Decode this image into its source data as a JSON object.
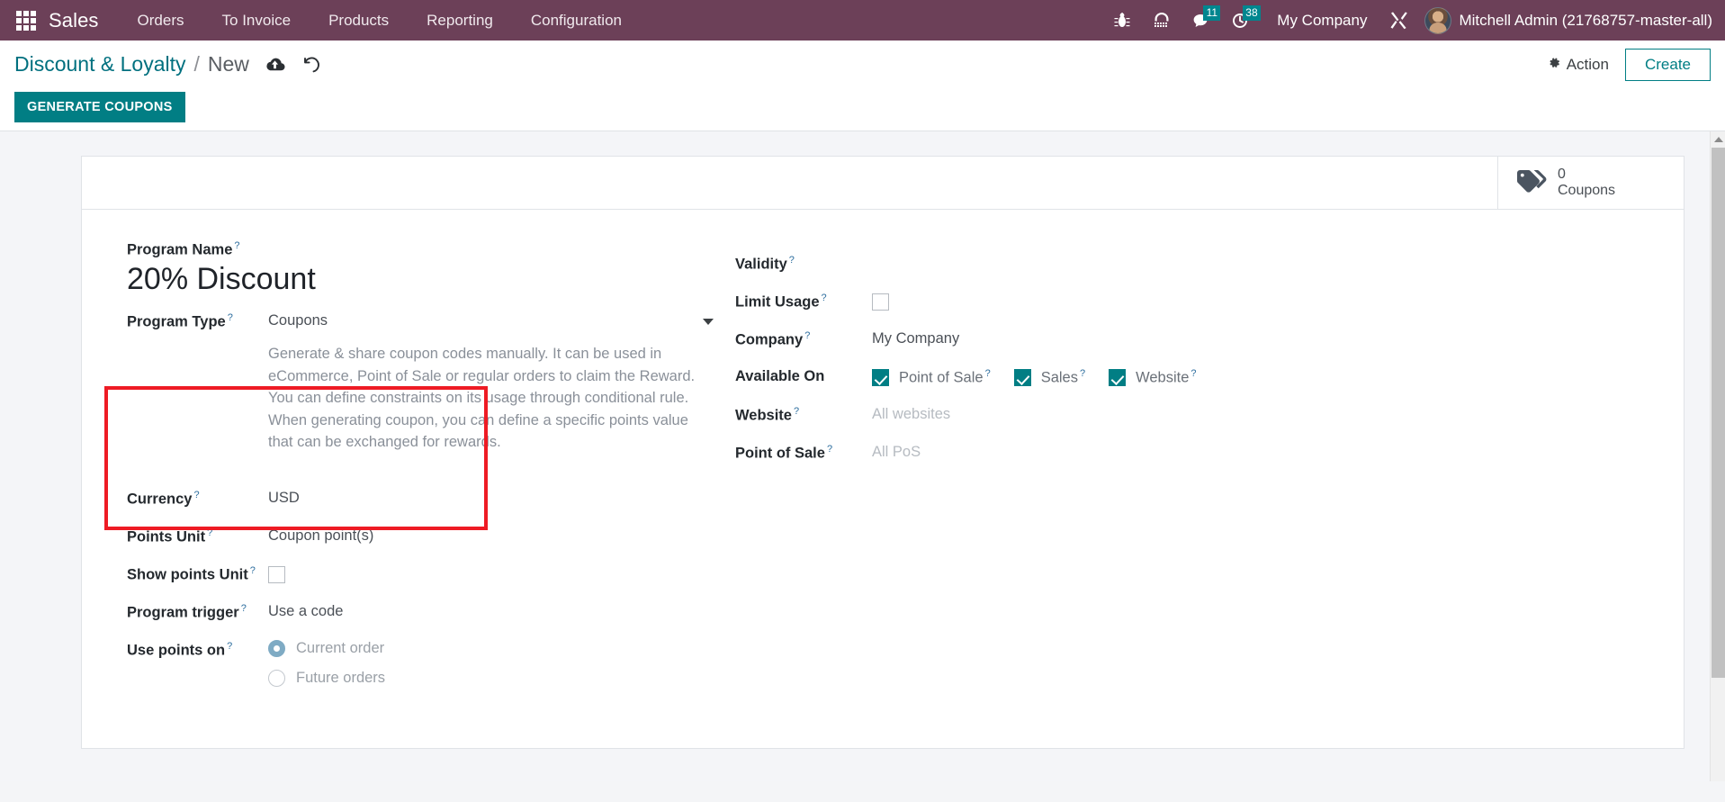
{
  "colors": {
    "navbar_purple": "#6c4058",
    "teal": "#017e84",
    "breadcrumb_link": "#00707f",
    "annotation_red": "#ee1b24",
    "badge_teal": "#00868f"
  },
  "navbar": {
    "apps_icon": "apps-grid-icon",
    "brand": "Sales",
    "menu": [
      {
        "label": "Orders"
      },
      {
        "label": "To Invoice"
      },
      {
        "label": "Products"
      },
      {
        "label": "Reporting"
      },
      {
        "label": "Configuration"
      }
    ],
    "icons": [
      {
        "name": "bug-icon",
        "badge": ""
      },
      {
        "name": "headset-support-icon",
        "badge": ""
      },
      {
        "name": "messages-icon",
        "badge": "11"
      },
      {
        "name": "activities-clock-icon",
        "badge": "38"
      }
    ],
    "company": "My Company",
    "tools_icon": "tools-wrench-icon",
    "avatar": "user-avatar",
    "user": "Mitchell Admin (21768757-master-all)"
  },
  "control_panel": {
    "breadcrumb": {
      "root": "Discount & Loyalty",
      "separator": "/",
      "current": "New"
    },
    "save_icon": "cloud-upload-save-icon",
    "discard_icon": "undo-discard-icon",
    "action_label": "Action",
    "action_icon": "gear-icon",
    "create_label": "Create",
    "generate_coupons_label": "GENERATE COUPONS"
  },
  "stat_button": {
    "icon": "tags-icon",
    "value": "0",
    "label": "Coupons"
  },
  "form": {
    "program_name": {
      "label": "Program Name",
      "value": "20% Discount",
      "help": "?"
    },
    "program_type": {
      "label": "Program Type",
      "value": "Coupons",
      "help": "?",
      "description": "Generate & share coupon codes manually. It can be used in eCommerce, Point of Sale or regular orders to claim the Reward. You can define constraints on its usage through conditional rule. When generating coupon, you can define a specific points value that can be exchanged for rewards."
    },
    "left_fields": [
      {
        "label": "Currency",
        "help": "?",
        "value": "USD",
        "type": "text"
      },
      {
        "label": "Points Unit",
        "help": "?",
        "value": "Coupon point(s)",
        "type": "text"
      },
      {
        "label": "Show points Unit",
        "help": "?",
        "value": "",
        "type": "checkbox",
        "checked": false
      },
      {
        "label": "Program trigger",
        "help": "?",
        "value": "Use a code",
        "type": "text"
      }
    ],
    "use_points_on": {
      "label": "Use points on",
      "help": "?",
      "options": [
        {
          "label": "Current order",
          "selected": true
        },
        {
          "label": "Future orders",
          "selected": false
        }
      ]
    },
    "right_fields": [
      {
        "label": "Validity",
        "help": "?",
        "value": "",
        "type": "text"
      },
      {
        "label": "Limit Usage",
        "help": "?",
        "value": "",
        "type": "checkbox",
        "checked": false
      },
      {
        "label": "Company",
        "help": "?",
        "value": "My Company",
        "type": "text"
      }
    ],
    "available_on": {
      "label": "Available On",
      "options": [
        {
          "label": "Point of Sale",
          "help": "?",
          "checked": true
        },
        {
          "label": "Sales",
          "help": "?",
          "checked": true
        },
        {
          "label": "Website",
          "help": "?",
          "checked": true
        }
      ]
    },
    "website_field": {
      "label": "Website",
      "help": "?",
      "placeholder": "All websites"
    },
    "pos_field": {
      "label": "Point of Sale",
      "help": "?",
      "placeholder": "All PoS"
    }
  }
}
